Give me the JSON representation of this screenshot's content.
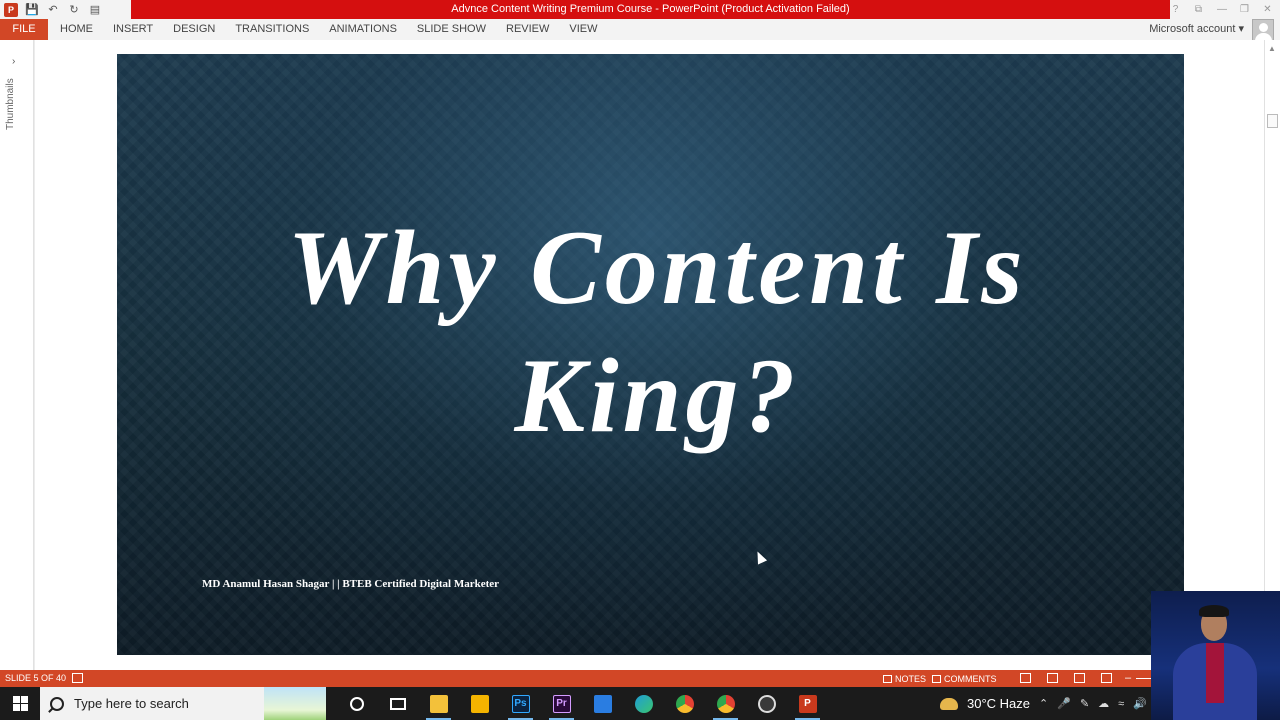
{
  "window": {
    "title": "Advnce Content Writing Premium Course -  PowerPoint (Product Activation Failed)",
    "help_glyph": "?",
    "restore_glyph": "⧉",
    "minimize_glyph": "—",
    "maximize_glyph": "❐",
    "close_glyph": "✕"
  },
  "ribbon": {
    "file_tab": "FILE",
    "tabs": [
      "HOME",
      "INSERT",
      "DESIGN",
      "TRANSITIONS",
      "ANIMATIONS",
      "SLIDE SHOW",
      "REVIEW",
      "VIEW"
    ],
    "account": "Microsoft account",
    "account_chevron": "▾"
  },
  "thumbnails_pane": {
    "label": "Thumbnails",
    "chevron": "›"
  },
  "slide": {
    "title_line1": "Why Content Is",
    "title_line2": "King?",
    "footer": "MD Anamul Hasan Shagar | | BTEB Certified Digital Marketer"
  },
  "statusbar": {
    "slide_counter": "SLIDE 5 OF 40",
    "notes": "NOTES",
    "comments": "COMMENTS",
    "zoom_minus": "–"
  },
  "taskbar": {
    "search_placeholder": "Type here to search",
    "apps": [
      {
        "name": "file-explorer",
        "label": "",
        "color": "#f3c13a"
      },
      {
        "name": "microsoft-store",
        "label": "",
        "color": "#f5b400"
      },
      {
        "name": "photoshop",
        "label": "Ps",
        "color": "#0b2340"
      },
      {
        "name": "premiere-pro",
        "label": "Pr",
        "color": "#2a0a3a"
      },
      {
        "name": "mail",
        "label": "",
        "color": "#2a7de1"
      },
      {
        "name": "edge",
        "label": "",
        "color": "#1f9dd6"
      },
      {
        "name": "chrome",
        "label": "",
        "color": "#e34133"
      },
      {
        "name": "chrome-2",
        "label": "",
        "color": "#e34133"
      },
      {
        "name": "screen-recorder",
        "label": "",
        "color": "#3a3a3a"
      },
      {
        "name": "powerpoint",
        "label": "P",
        "color": "#c9391d"
      }
    ],
    "weather": "30°C  Haze"
  },
  "colors": {
    "ppt_orange": "#d24726",
    "title_red": "#d50f0f",
    "slide_bg": "#17303f"
  }
}
